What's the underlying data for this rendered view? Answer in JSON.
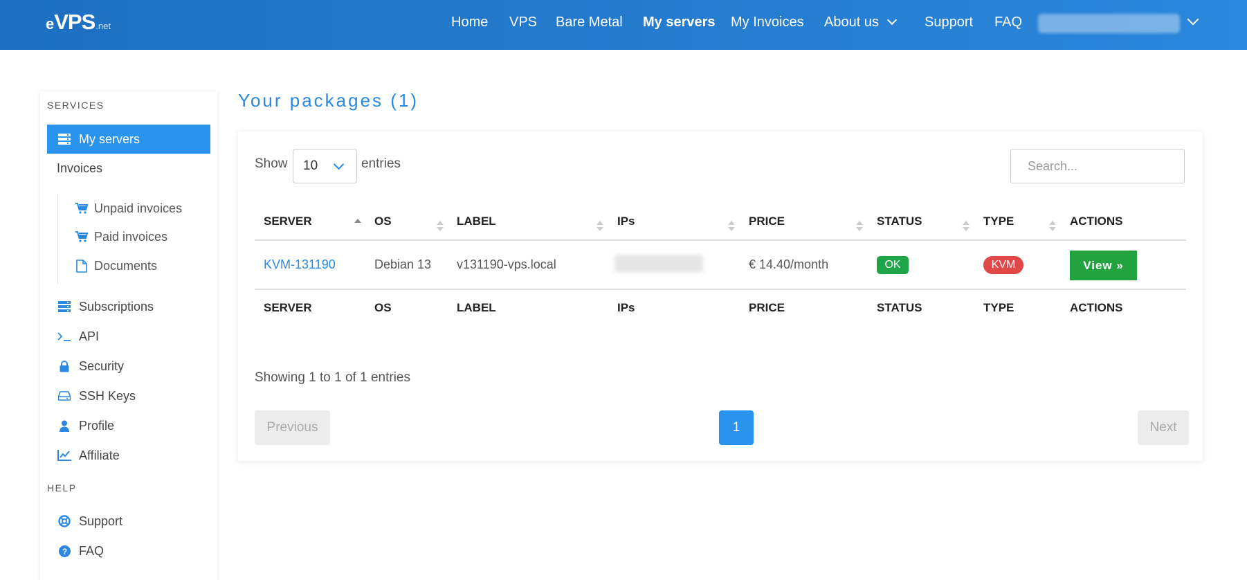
{
  "header": {
    "logo": {
      "part1": "e",
      "part2": "VPS",
      "part3": ".net"
    },
    "nav": [
      {
        "label": "Home"
      },
      {
        "label": "VPS"
      },
      {
        "label": "Bare Metal"
      },
      {
        "label": "My servers",
        "active": true
      },
      {
        "label": "My Invoices"
      },
      {
        "label": "About us"
      },
      {
        "label": "Support"
      },
      {
        "label": "FAQ"
      }
    ]
  },
  "sidebar": {
    "services_title": "SERVICES",
    "help_title": "HELP",
    "items": {
      "my_servers": "My servers",
      "invoices": "Invoices",
      "unpaid_invoices": "Unpaid invoices",
      "paid_invoices": "Paid invoices",
      "documents": "Documents",
      "subscriptions": "Subscriptions",
      "api": "API",
      "security": "Security",
      "ssh_keys": "SSH Keys",
      "profile": "Profile",
      "affiliate": "Affiliate",
      "support": "Support",
      "faq": "FAQ"
    }
  },
  "main": {
    "title": "Your packages (1)",
    "show_label": "Show",
    "entries_value": "10",
    "entries_label": "entries",
    "search_placeholder": "Search...",
    "columns": [
      "SERVER",
      "OS",
      "LABEL",
      "IPs",
      "PRICE",
      "STATUS",
      "TYPE",
      "ACTIONS"
    ],
    "rows": [
      {
        "server": "KVM-131190",
        "os": "Debian 13",
        "label": "v131190-vps.local",
        "price": "€ 14.40/month",
        "status": "OK",
        "type": "KVM",
        "action": "View »"
      }
    ],
    "showing_text": "Showing 1 to 1 of 1 entries",
    "pagination": {
      "previous": "Previous",
      "page": "1",
      "next": "Next"
    }
  },
  "colors": {
    "brand_blue": "#2a88e0",
    "active_blue": "#2a93ee",
    "status_ok": "#1fa447",
    "type_kvm": "#e04848",
    "view_button": "#23a33f"
  }
}
